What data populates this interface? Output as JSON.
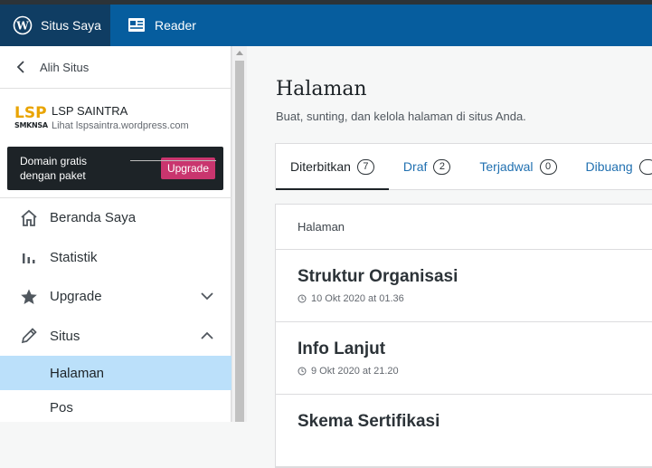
{
  "masterbar": {
    "my_sites": "Situs Saya",
    "reader": "Reader"
  },
  "sidebar": {
    "switch_site": "Alih Situs",
    "site": {
      "logo_top": "LSP",
      "logo_bottom": "SMKNSA",
      "name": "LSP SAINTRA",
      "url": "Lihat lspsaintra.wordpress.com"
    },
    "upsell": {
      "text": "Domain gratis dengan paket",
      "button": "Upgrade"
    },
    "items": [
      {
        "label": "Beranda Saya",
        "icon": "home-icon"
      },
      {
        "label": "Statistik",
        "icon": "stats-icon"
      },
      {
        "label": "Upgrade",
        "icon": "star-icon",
        "chevron": "down"
      },
      {
        "label": "Situs",
        "icon": "pencil-icon",
        "chevron": "up"
      }
    ],
    "subitems": [
      {
        "label": "Halaman",
        "active": true
      },
      {
        "label": "Pos",
        "active": false
      }
    ]
  },
  "main": {
    "title": "Halaman",
    "subtitle": "Buat, sunting, dan kelola halaman di situs Anda.",
    "tabs": [
      {
        "label": "Diterbitkan",
        "count": "7",
        "active": true
      },
      {
        "label": "Draf",
        "count": "2",
        "active": false
      },
      {
        "label": "Terjadwal",
        "count": "0",
        "active": false
      },
      {
        "label": "Dibuang",
        "count": "",
        "active": false
      }
    ],
    "list_header": "Halaman",
    "pages": [
      {
        "title": "Struktur Organisasi",
        "date": "10 Okt 2020 at 01.36"
      },
      {
        "title": "Info Lanjut",
        "date": "9 Okt 2020 at 21.20"
      },
      {
        "title": "Skema Sertifikasi",
        "date": ""
      }
    ]
  },
  "colors": {
    "masterbar": "#065d9e",
    "masterbar_active": "#0f3d63",
    "upgrade_button": "#c9356e",
    "active_nav": "#bbe0fa",
    "link": "#2271b1",
    "logo_gold": "#e9a400"
  }
}
